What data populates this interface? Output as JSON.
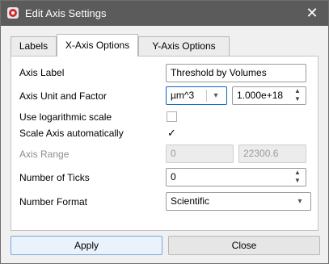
{
  "window": {
    "title": "Edit Axis Settings",
    "icon": "app-logo-icon",
    "close_icon": "close-icon"
  },
  "tabs": [
    {
      "label": "Labels",
      "active": false
    },
    {
      "label": "X-Axis Options",
      "active": true
    },
    {
      "label": "Y-Axis Options",
      "active": false
    }
  ],
  "form": {
    "axis_label": {
      "label": "Axis Label",
      "value": "Threshold by Volumes"
    },
    "axis_unit": {
      "label": "Axis Unit and Factor",
      "unit_value": "µm^3",
      "factor_value": "1.000e+18"
    },
    "log_scale": {
      "label": "Use logarithmic scale",
      "checked": false
    },
    "scale_auto": {
      "label": "Scale Axis automatically",
      "checked": true,
      "check_glyph": "✓"
    },
    "axis_range": {
      "label": "Axis Range",
      "min": "0",
      "max": "22300.6",
      "disabled": true
    },
    "num_ticks": {
      "label": "Number of Ticks",
      "value": "0"
    },
    "number_format": {
      "label": "Number Format",
      "value": "Scientific"
    }
  },
  "buttons": {
    "apply": "Apply",
    "close": "Close"
  },
  "glyphs": {
    "close": "✕",
    "chevron_down": "▾",
    "spin_up": "▲",
    "spin_down": "▼"
  },
  "colors": {
    "titlebar": "#5b5b5b",
    "focus_border": "#0a64c8",
    "app_icon": "#d42a2a"
  }
}
